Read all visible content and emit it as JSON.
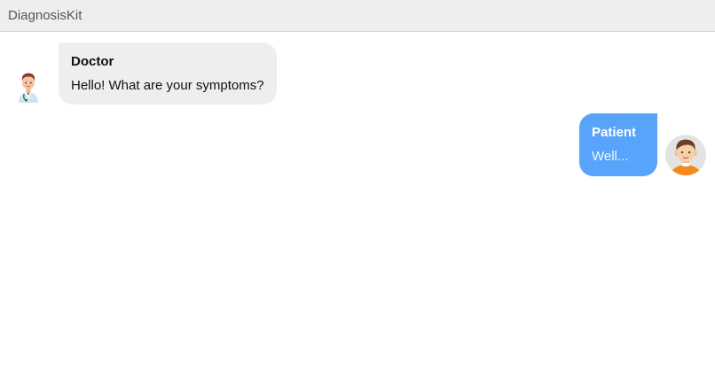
{
  "header": {
    "title": "DiagnosisKit"
  },
  "messages": [
    {
      "sender": "Doctor",
      "text": "Hello! What are your symptoms?",
      "avatar_icon": "doctor-avatar-icon",
      "bubble_color": "#eeeeee"
    },
    {
      "sender": "Patient",
      "text": "Well...",
      "avatar_icon": "patient-avatar-icon",
      "bubble_color": "#58a3fb"
    }
  ]
}
